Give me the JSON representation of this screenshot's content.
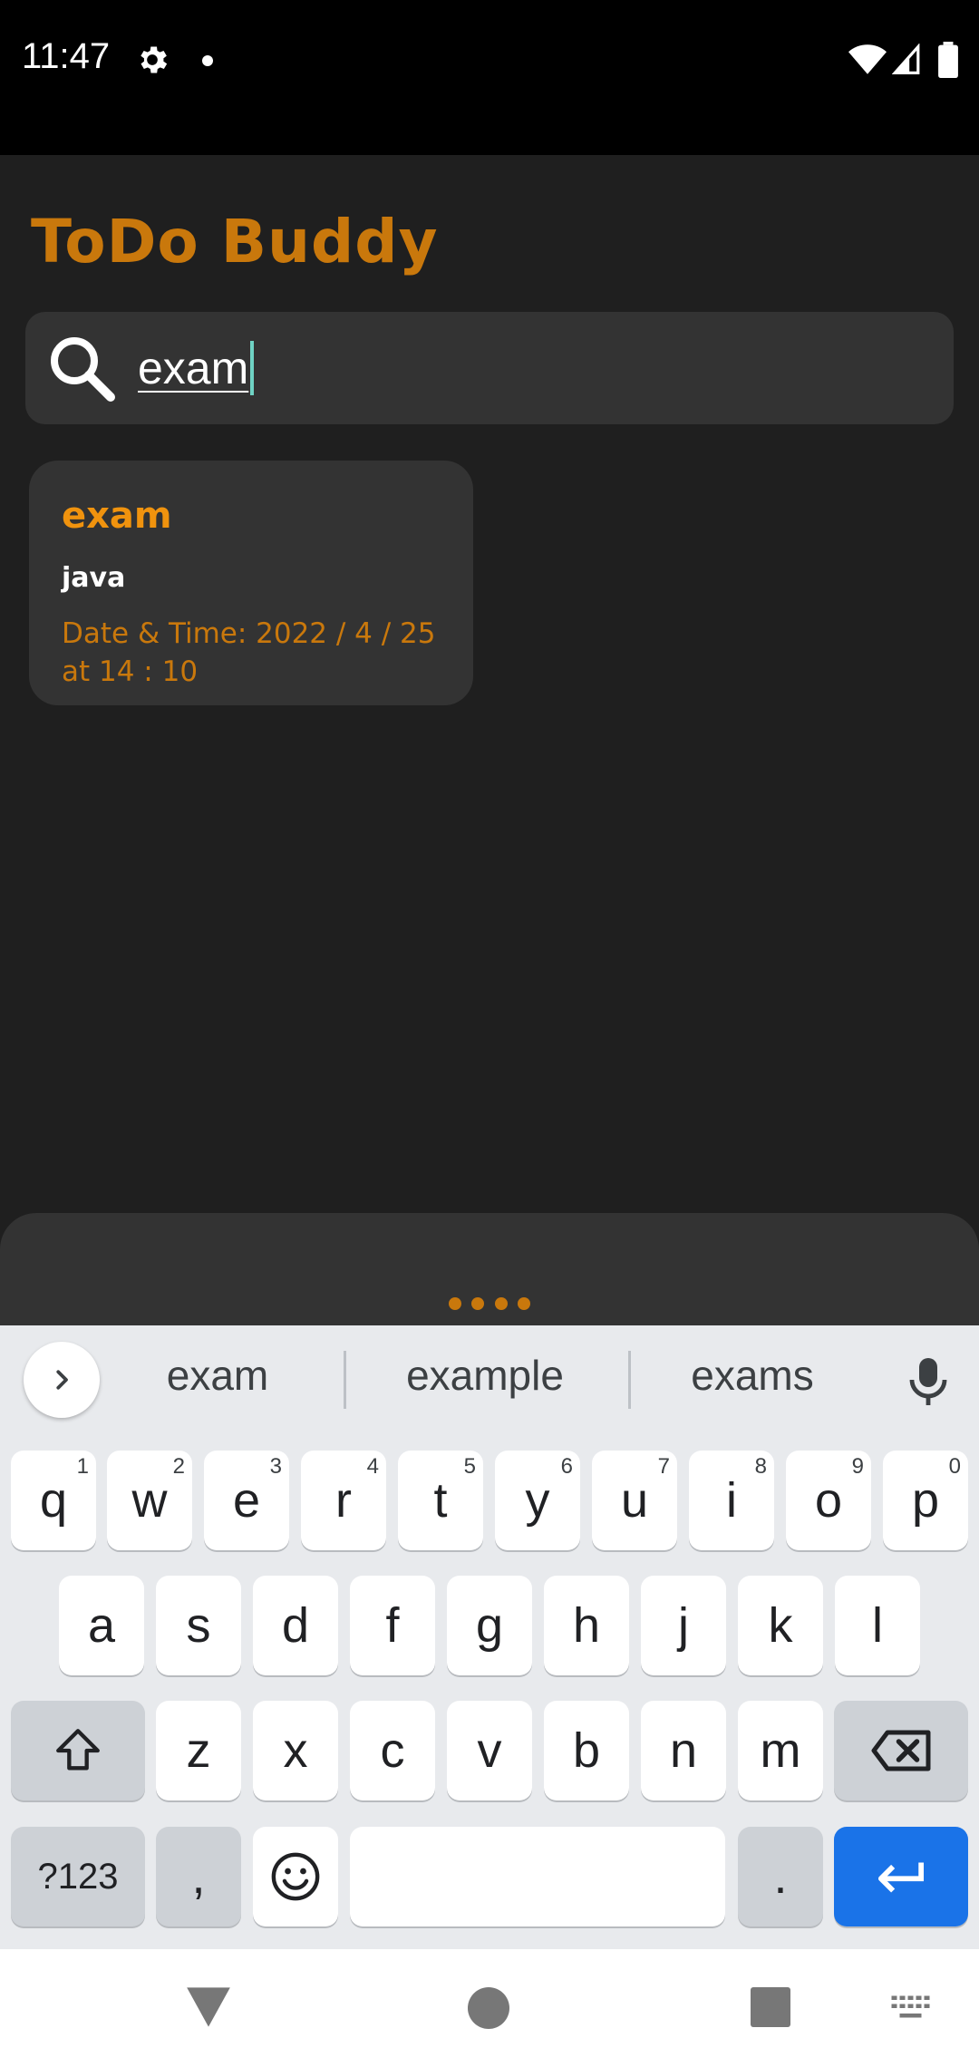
{
  "status_bar": {
    "time": "11:47",
    "icons": [
      "gear-icon",
      "notification-dot",
      "wifi-icon",
      "signal-icon",
      "battery-icon"
    ]
  },
  "app": {
    "title": "ToDo Buddy",
    "accent_color": "#c9780c"
  },
  "search": {
    "value": "exam",
    "icon": "search-icon"
  },
  "results": [
    {
      "title": "exam",
      "description": "java",
      "date_time": "Date & Time:  2022 / 4 / 25  at  14 : 10"
    }
  ],
  "keyboard": {
    "suggestions": [
      "exam",
      "example",
      "exams"
    ],
    "row1": [
      {
        "key": "q",
        "hint": "1"
      },
      {
        "key": "w",
        "hint": "2"
      },
      {
        "key": "e",
        "hint": "3"
      },
      {
        "key": "r",
        "hint": "4"
      },
      {
        "key": "t",
        "hint": "5"
      },
      {
        "key": "y",
        "hint": "6"
      },
      {
        "key": "u",
        "hint": "7"
      },
      {
        "key": "i",
        "hint": "8"
      },
      {
        "key": "o",
        "hint": "9"
      },
      {
        "key": "p",
        "hint": "0"
      }
    ],
    "row2": [
      "a",
      "s",
      "d",
      "f",
      "g",
      "h",
      "j",
      "k",
      "l"
    ],
    "row3": [
      "z",
      "x",
      "c",
      "v",
      "b",
      "n",
      "m"
    ],
    "symbols_label": "?123",
    "comma": ",",
    "period": ".",
    "enter_color": "#1a73e8"
  },
  "nav_bar": {
    "icons": [
      "back-icon",
      "home-icon",
      "recents-icon",
      "keyboard-switch-icon"
    ]
  }
}
